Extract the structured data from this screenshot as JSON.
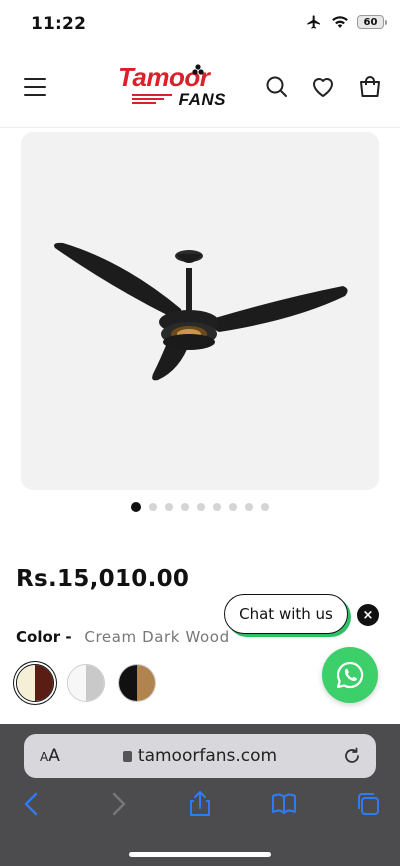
{
  "status_bar": {
    "time": "11:22",
    "battery": "60"
  },
  "header": {
    "logo_top": "Tamoor",
    "logo_bottom": "FANS"
  },
  "gallery": {
    "slide_count": 9,
    "active_slide": 1
  },
  "product": {
    "price": "Rs.15,010.00",
    "color_label": "Color -",
    "color_value": "Cream Dark Wood",
    "swatches": [
      {
        "name": "Cream Dark Wood",
        "left": "#f5efd6",
        "right": "#5a1d14",
        "selected": true
      },
      {
        "name": "White Silver",
        "left": "#f7f7f7",
        "right": "#c9c9c9",
        "selected": false
      },
      {
        "name": "Black Wood",
        "left": "#111111",
        "right": "#b0844e",
        "selected": false
      }
    ]
  },
  "chat": {
    "pill_label": "Chat with us",
    "close_glyph": "×"
  },
  "browser": {
    "aa_label": "AA",
    "url": "tamoorfans.com"
  },
  "colors": {
    "brand_red": "#d8222a",
    "whatsapp_green": "#3dcf6a",
    "safari_bar": "#4c4c4f",
    "link_blue": "#2f7bf5"
  }
}
